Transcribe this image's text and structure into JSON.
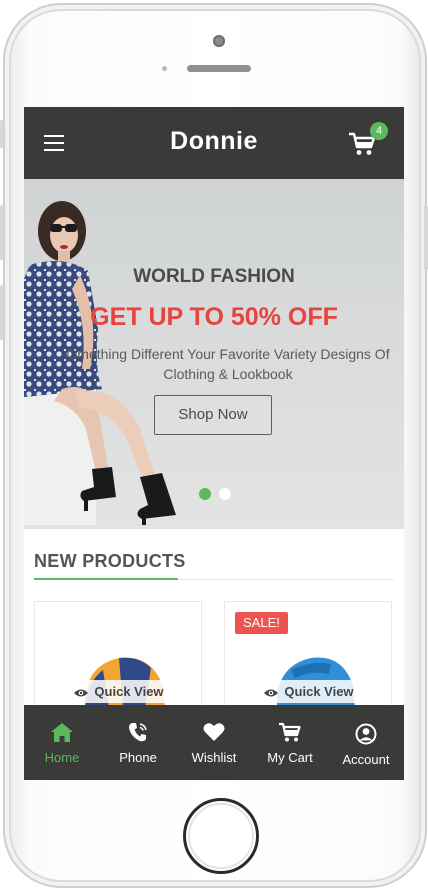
{
  "app": {
    "brand": "Donnie",
    "cart_count": "4"
  },
  "hero": {
    "title": "WORLD FASHION",
    "sale": "GET UP TO 50% OFF",
    "description": "Omething Different Your Favorite Variety Designs Of Clothing & Lookbook",
    "button": "Shop Now",
    "slides": 2,
    "active_slide": 1
  },
  "products": {
    "section_title": "NEW PRODUCTS",
    "items": [
      {
        "quick_view": "Quick View",
        "badge": ""
      },
      {
        "quick_view": "Quick View",
        "badge": "SALE!"
      }
    ]
  },
  "bottom_nav": {
    "items": [
      {
        "label": "Home",
        "icon": "home-icon",
        "active": true
      },
      {
        "label": "Phone",
        "icon": "phone-icon",
        "active": false
      },
      {
        "label": "Wishlist",
        "icon": "heart-icon",
        "active": false
      },
      {
        "label": "My Cart",
        "icon": "cart-icon",
        "active": false
      },
      {
        "label": "Account",
        "icon": "user-circle-icon",
        "active": false
      }
    ]
  },
  "colors": {
    "bar": "#3a3a38",
    "accent": "#5cb85c",
    "sale_text": "#e8433c",
    "sale_badge": "#ef5350"
  }
}
